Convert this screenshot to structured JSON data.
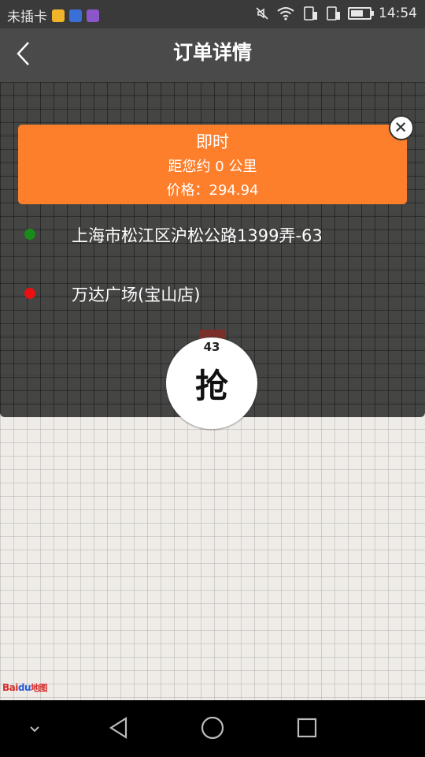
{
  "status_bar": {
    "carrier": "未插卡",
    "time": "14:54",
    "battery_level": 0.6
  },
  "header": {
    "title": "订单详情",
    "back_icon": "chevron-left-icon"
  },
  "order": {
    "type": "即时",
    "distance": "距您约 0 公里",
    "price": "价格：294.94",
    "card_color": "#fd7f2c",
    "close_icon": "close-icon"
  },
  "route": {
    "start": {
      "address": "上海市松江区沪松公路1399弄-63",
      "dot_color": "#1a8a1a"
    },
    "end": {
      "address": "万达广场(宝山店)",
      "dot_color": "#e81010"
    }
  },
  "grab_button": {
    "countdown": "43",
    "label": "抢"
  },
  "map": {
    "logo_bai": "Bai",
    "logo_du": "du",
    "logo_map": "地图"
  },
  "nav": {
    "icons": [
      "chevron-down-icon",
      "back-triangle-icon",
      "home-circle-icon",
      "recents-square-icon"
    ]
  }
}
